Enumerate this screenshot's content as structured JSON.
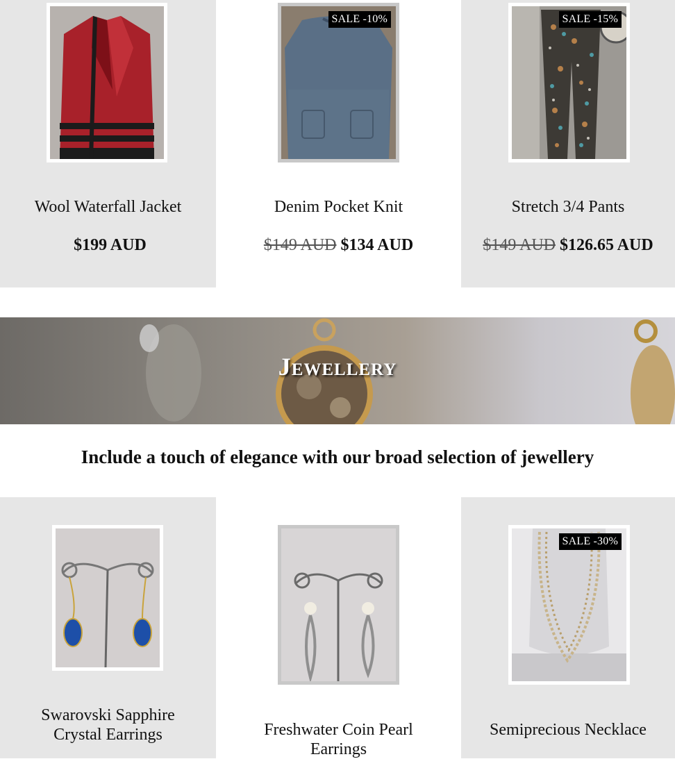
{
  "clothing": [
    {
      "name": "Wool Waterfall Jacket",
      "price": "$199 AUD",
      "old_price": "",
      "sale": ""
    },
    {
      "name": "Denim Pocket Knit",
      "price": "$134 AUD",
      "old_price": "$149 AUD",
      "sale": "SALE -10%"
    },
    {
      "name": "Stretch 3/4 Pants",
      "price": "$126.65 AUD",
      "old_price": "$149 AUD",
      "sale": "SALE -15%"
    }
  ],
  "banner": {
    "title": "Jewellery"
  },
  "tagline": "Include a touch of elegance with our broad selection of jewellery",
  "jewellery": [
    {
      "name_line1": "Swarovski Sapphire",
      "name_line2": "Crystal Earrings"
    },
    {
      "name_line1": "Freshwater Coin Pearl",
      "name_line2": "Earrings"
    },
    {
      "name_line1": "Semiprecious Necklace",
      "name_line2": "",
      "sale": "SALE -30%"
    }
  ]
}
